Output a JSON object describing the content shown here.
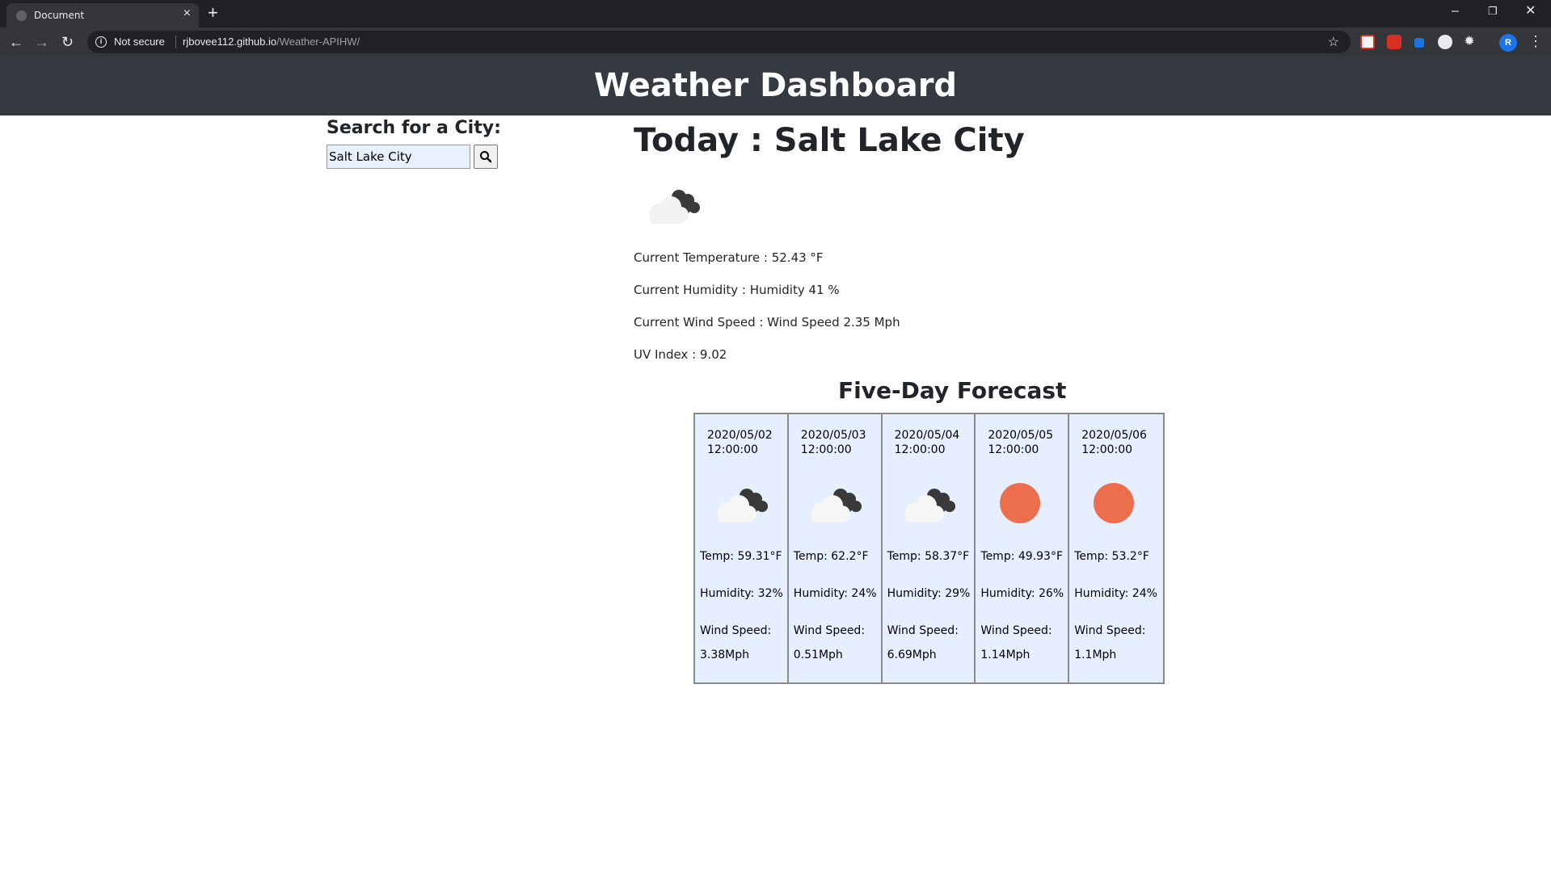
{
  "browser": {
    "tab_title": "Document",
    "close_glyph": "×",
    "new_tab_glyph": "+",
    "security_label": "Not secure",
    "url_host": "rjbovee112.github.io",
    "url_path": "/Weather-APIHW/",
    "avatar_letter": "R"
  },
  "header": {
    "title": "Weather Dashboard",
    "background": "#343a40"
  },
  "search": {
    "label": "Search for a City:",
    "value": "Salt Lake City"
  },
  "today": {
    "title": "Today : Salt Lake City",
    "icon": "broken-clouds-icon",
    "temperature": "Current Temperature : 52.43 °F",
    "humidity": "Current Humidity : Humidity 41 %",
    "wind": "Current Wind Speed : Wind Speed 2.35 Mph",
    "uv": "UV Index : 9.02"
  },
  "forecast": {
    "title": "Five-Day Forecast",
    "card_background": "#e6efff",
    "days": [
      {
        "date": "2020/05/02 12:00:00",
        "icon": "broken-clouds-icon",
        "temp": "Temp: 59.31°F",
        "humidity": "Humidity: 32%",
        "wind_label": "Wind Speed:",
        "wind_value": "3.38Mph"
      },
      {
        "date": "2020/05/03 12:00:00",
        "icon": "broken-clouds-icon",
        "temp": "Temp: 62.2°F",
        "humidity": "Humidity: 24%",
        "wind_label": "Wind Speed:",
        "wind_value": "0.51Mph"
      },
      {
        "date": "2020/05/04 12:00:00",
        "icon": "broken-clouds-icon",
        "temp": "Temp: 58.37°F",
        "humidity": "Humidity: 29%",
        "wind_label": "Wind Speed:",
        "wind_value": "6.69Mph"
      },
      {
        "date": "2020/05/05 12:00:00",
        "icon": "clear-sky-sun-icon",
        "temp": "Temp: 49.93°F",
        "humidity": "Humidity: 26%",
        "wind_label": "Wind Speed:",
        "wind_value": "1.14Mph"
      },
      {
        "date": "2020/05/06 12:00:00",
        "icon": "clear-sky-sun-icon",
        "temp": "Temp: 53.2°F",
        "humidity": "Humidity: 24%",
        "wind_label": "Wind Speed:",
        "wind_value": "1.1Mph"
      }
    ],
    "sun_color": "#ec6e4c"
  }
}
